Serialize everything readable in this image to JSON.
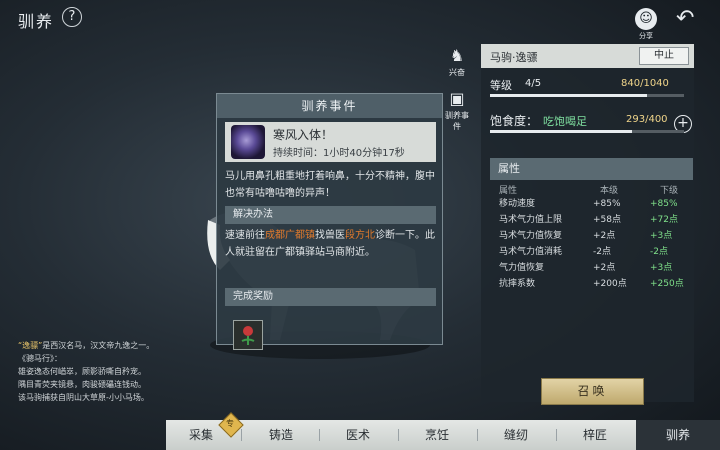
{
  "header": {
    "title": "驯养",
    "help_glyph": "?",
    "share_label": "分享",
    "back_glyph": "↶"
  },
  "side_icons": [
    {
      "label": "兴奋",
      "icon": "horse-excite-icon"
    },
    {
      "label": "驯养事件",
      "icon": "event-scroll-icon"
    }
  ],
  "event_panel": {
    "title": "驯养事件",
    "event_name": "寒风入体！",
    "duration_label": "持续时间：",
    "duration_value": "1小时40分钟17秒",
    "description": "马儿用鼻孔粗重地打着响鼻，十分不精神，腹中也常有咕噜咕噜的异声！",
    "solution_header": "解决办法",
    "solution_parts": {
      "p1": "速速前往",
      "place": "成都广都镇",
      "p2": "找兽医",
      "doctor": "段方北",
      "p3": "诊断一下。此人就驻留在广都镇驿站马商附近。"
    },
    "reward_header": "完成奖励",
    "reward_icon": "herb-flower-icon"
  },
  "horse_panel": {
    "name": "马驹·逸骠",
    "stop_label": "中止",
    "level_label": "等级",
    "level_value": "4/5",
    "exp_text": "840/1040",
    "exp_fraction": 0.81,
    "satiety_label": "饱食度：",
    "satiety_state": "吃饱喝足",
    "satiety_text": "293/400",
    "satiety_fraction": 0.73,
    "plus_glyph": "+",
    "attr_header": "属性",
    "attr_cols": [
      "属性",
      "本级",
      "下级"
    ],
    "attributes": [
      {
        "name": "移动速度",
        "cur": "+85%",
        "next": "+85%"
      },
      {
        "name": "马术气力值上限",
        "cur": "+58点",
        "next": "+72点"
      },
      {
        "name": "马术气力值恢复",
        "cur": "+2点",
        "next": "+3点"
      },
      {
        "name": "马术气力值消耗",
        "cur": "-2点",
        "next": "-2点"
      },
      {
        "name": "气力值恢复",
        "cur": "+2点",
        "next": "+3点"
      },
      {
        "name": "抗摔系数",
        "cur": "+200点",
        "next": "+250点"
      }
    ],
    "summon_label": "召唤"
  },
  "lore": {
    "line1_quote": "“逸骠”",
    "line1_rest": "是西汉名马，汉文帝九逸之一。",
    "line2": "《骢马行》：",
    "line3": "雄姿逸态何崷崒，顾影骄嘶自矜宠。",
    "line4": "隅目青荧夹镜悬，肉骏碨礧连钱动。",
    "line5": "该马驹捕获自阴山大草原-小小马场。"
  },
  "tabs": [
    {
      "label": "采集"
    },
    {
      "label": "铸造"
    },
    {
      "label": "医术"
    },
    {
      "label": "烹饪"
    },
    {
      "label": "缝纫"
    },
    {
      "label": "梓匠"
    },
    {
      "label": "驯养"
    }
  ],
  "tab_badge": "专",
  "colors": {
    "highlight": "#e07a2c",
    "positive": "#7fe08a",
    "gold": "#e8c46a"
  }
}
